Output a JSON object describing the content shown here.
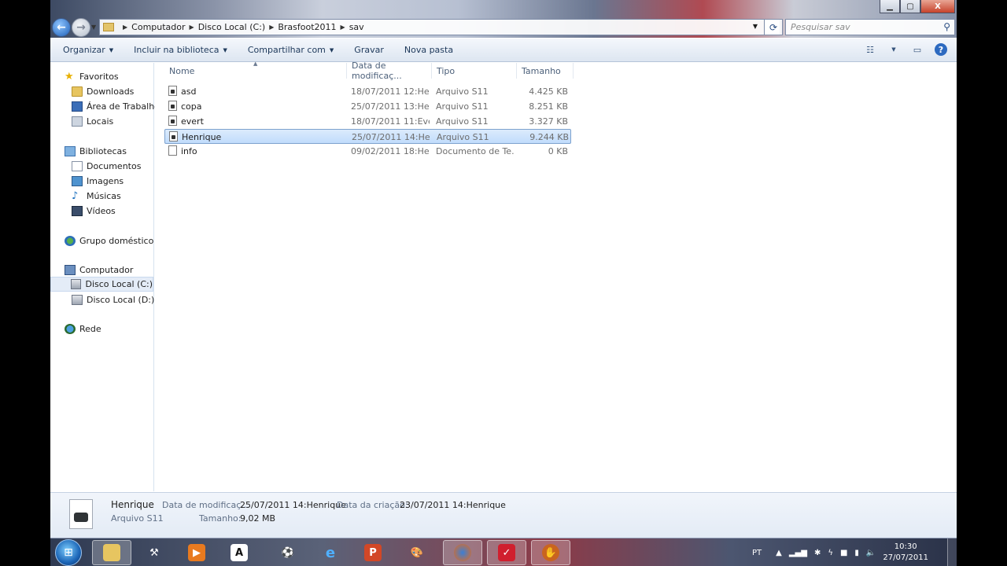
{
  "window": {
    "controls": {
      "minimize": "▁",
      "maximize": "▢",
      "close": "X"
    }
  },
  "nav": {
    "back": "←",
    "forward": "→"
  },
  "address": {
    "breadcrumbs": [
      "Computador",
      "Disco Local (C:)",
      "Brasfoot2011",
      "sav"
    ]
  },
  "search": {
    "placeholder": "Pesquisar sav"
  },
  "toolbar": {
    "organize": "Organizar",
    "include_library": "Incluir na biblioteca",
    "share": "Compartilhar com",
    "burn": "Gravar",
    "new_folder": "Nova pasta"
  },
  "sidebar": {
    "favorites": "Favoritos",
    "downloads": "Downloads",
    "desktop": "Área de Trabalho",
    "places": "Locais",
    "libraries": "Bibliotecas",
    "documents": "Documentos",
    "images": "Imagens",
    "music": "Músicas",
    "videos": "Vídeos",
    "homegroup": "Grupo doméstico",
    "computer": "Computador",
    "drive_c": "Disco Local (C:)",
    "drive_d": "Disco Local (D:)",
    "network": "Rede"
  },
  "columns": {
    "name": "Nome",
    "date": "Data de modificaç...",
    "type": "Tipo",
    "size": "Tamanho"
  },
  "files": [
    {
      "name": "asd",
      "date": "18/07/2011 12:He...",
      "type": "Arquivo S11",
      "size": "4.425 KB"
    },
    {
      "name": "copa",
      "date": "25/07/2011 13:He...",
      "type": "Arquivo S11",
      "size": "8.251 KB"
    },
    {
      "name": "evert",
      "date": "18/07/2011 11:Eve...",
      "type": "Arquivo S11",
      "size": "3.327 KB"
    },
    {
      "name": "Henrique",
      "date": "25/07/2011 14:He...",
      "type": "Arquivo S11",
      "size": "9.244 KB"
    },
    {
      "name": "info",
      "date": "09/02/2011 18:He...",
      "type": "Documento de Te...",
      "size": "0 KB"
    }
  ],
  "details": {
    "name": "Henrique",
    "type": "Arquivo S11",
    "modified_label": "Data de modificaç...",
    "modified_value": "25/07/2011 14:Henrique",
    "created_label": "Data da criação:",
    "created_value": "23/07/2011 14:Henrique",
    "size_label": "Tamanho:",
    "size_value": "9,02 MB"
  },
  "taskbar": {
    "language": "PT",
    "time": "10:30",
    "date": "27/07/2011"
  }
}
